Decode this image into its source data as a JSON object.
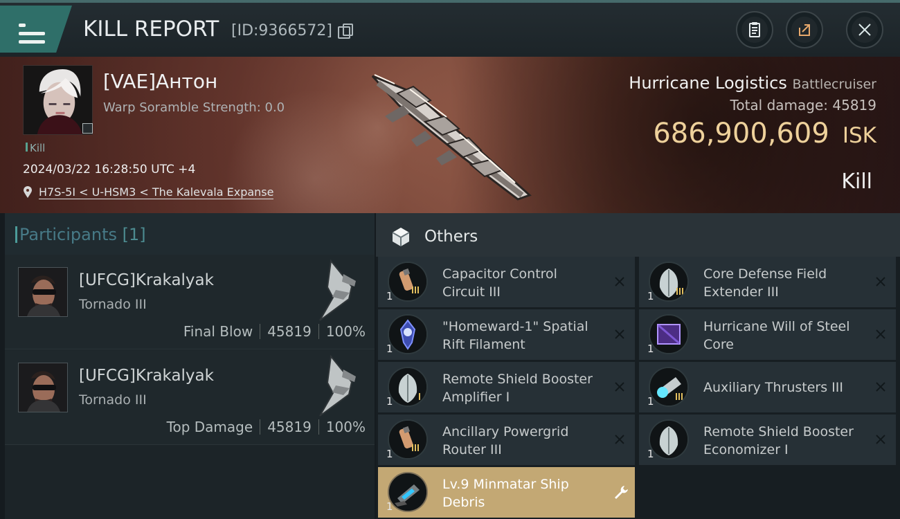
{
  "header": {
    "title": "KILL REPORT",
    "id_text": "[ID:9366572]",
    "buttons": [
      "clipboard-icon",
      "share-icon",
      "close-icon"
    ]
  },
  "victim": {
    "name": "[VAE]Антон",
    "warp_scramble": "Warp Soramble Strength: 0.0",
    "status": "Kill",
    "datetime": "2024/03/22 16:28:50 UTC +4",
    "location": "H7S-5I < U-HSM3 < The Kalevala Expanse",
    "ship_name": "Hurricane Logistics",
    "ship_class": "Battlecruiser",
    "total_damage_label": "Total damage:",
    "total_damage": "45819",
    "isk_value": "686,900,609",
    "isk_unit": "ISK",
    "result": "Kill"
  },
  "participants": {
    "title": "Participants",
    "count": "[1]",
    "rows": [
      {
        "name": "[UFCG]Krakalyak",
        "ship": "Tornado III",
        "label": "Final Blow",
        "damage": "45819",
        "percent": "100%"
      },
      {
        "name": "[UFCG]Krakalyak",
        "ship": "Tornado III",
        "label": "Top Damage",
        "damage": "45819",
        "percent": "100%"
      }
    ]
  },
  "others": {
    "title": "Others",
    "items": [
      {
        "qty": "1",
        "name": "Capacitor Control Circuit III"
      },
      {
        "qty": "1",
        "name": "Core Defense Field Extender III"
      },
      {
        "qty": "1",
        "name": "\"Homeward-1\" Spatial Rift Filament"
      },
      {
        "qty": "1",
        "name": "Hurricane Will of Steel Core"
      },
      {
        "qty": "1",
        "name": "Remote Shield Booster Amplifier I"
      },
      {
        "qty": "1",
        "name": "Auxiliary Thrusters III"
      },
      {
        "qty": "1",
        "name": "Ancillary Powergrid Router III"
      },
      {
        "qty": "1",
        "name": "Remote Shield Booster Economizer I"
      },
      {
        "qty": "1",
        "name": "Lv.9 Minmatar Ship Debris"
      }
    ]
  },
  "colors": {
    "accent": "#2f6f69",
    "isk": "#eed19b",
    "highlight": "#c3a874"
  }
}
